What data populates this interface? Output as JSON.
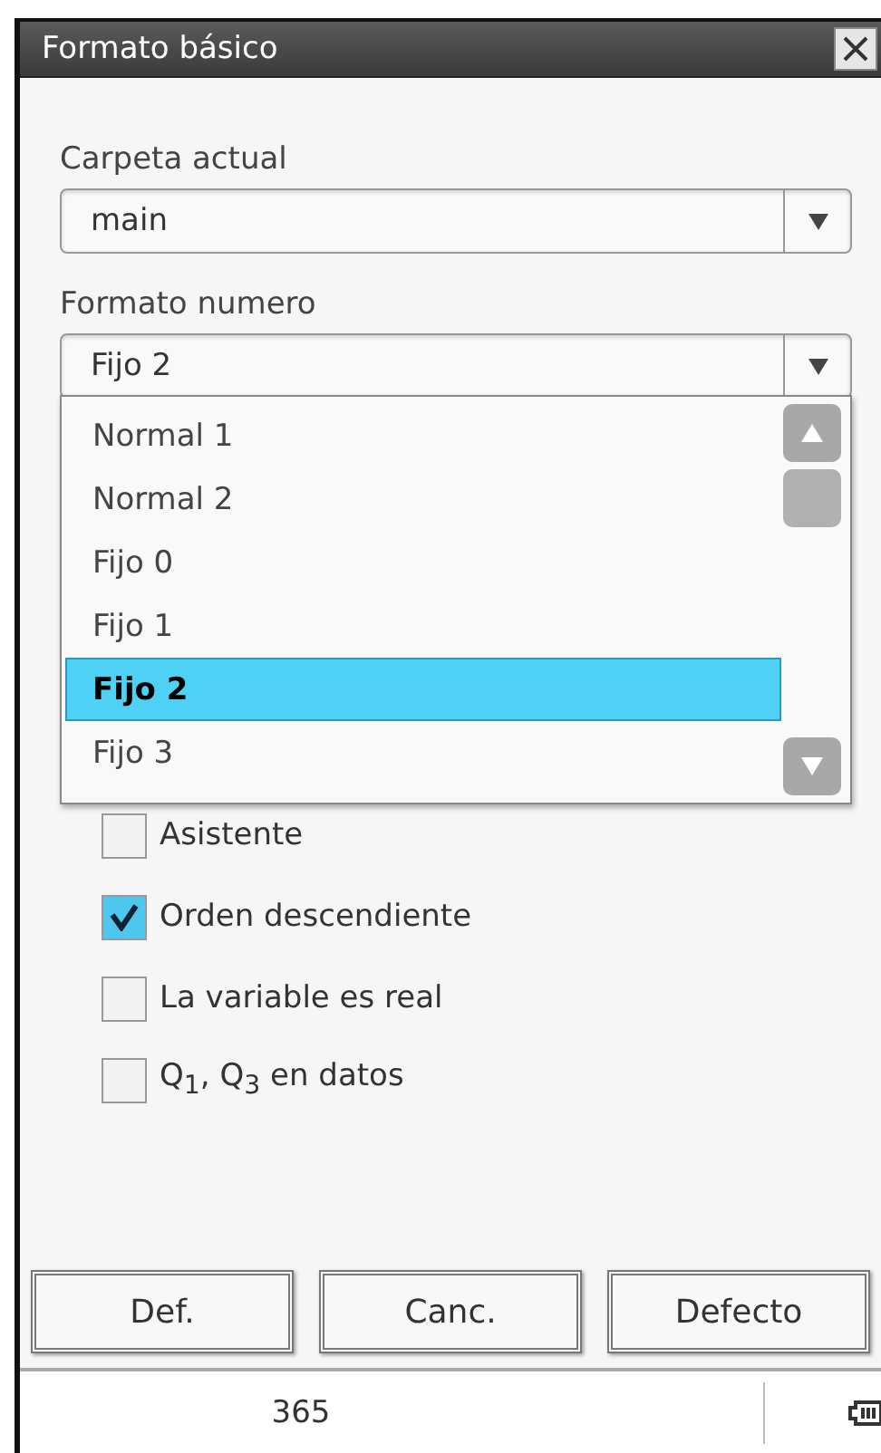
{
  "window": {
    "title": "Formato básico"
  },
  "fields": [
    {
      "label": "Carpeta actual",
      "value": "main"
    },
    {
      "label": "Formato numero",
      "value": "Fijo 2"
    }
  ],
  "dropdown": {
    "options": [
      {
        "label": "Normal 1",
        "selected": false
      },
      {
        "label": "Normal 2",
        "selected": false
      },
      {
        "label": "Fijo 0",
        "selected": false
      },
      {
        "label": "Fijo 1",
        "selected": false
      },
      {
        "label": "Fijo 2",
        "selected": true
      },
      {
        "label": "Fijo 3",
        "selected": false
      }
    ]
  },
  "checkboxes": [
    {
      "label": "Asistente",
      "checked": false
    },
    {
      "label": "Orden descendiente",
      "checked": true
    },
    {
      "label": "La variable es real",
      "checked": false
    },
    {
      "label": "Q$_{1}$, Q$_{3}$ en datos",
      "checked": false
    }
  ],
  "buttons": [
    "Def.",
    "Canc.",
    "Defecto"
  ],
  "status_bar": {
    "text": "365"
  }
}
